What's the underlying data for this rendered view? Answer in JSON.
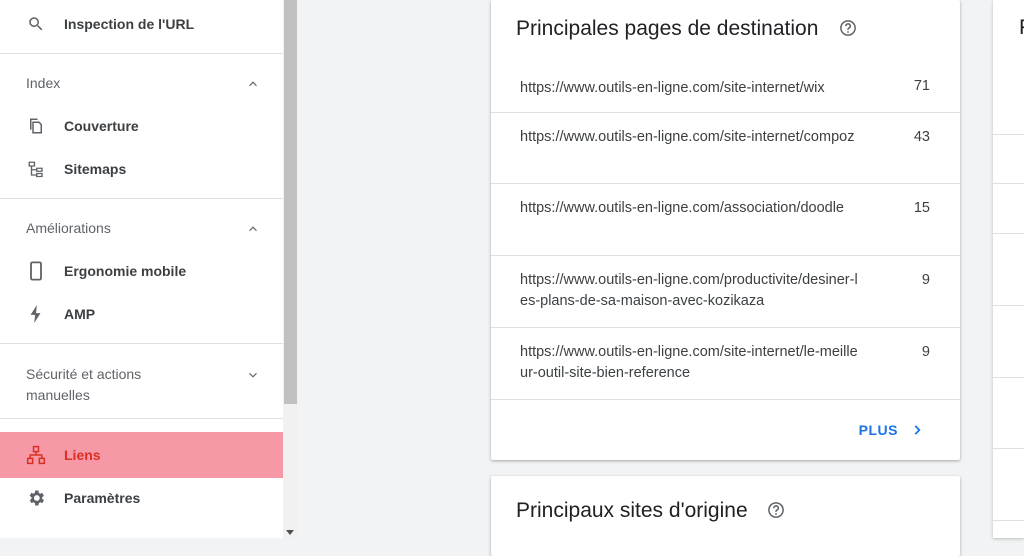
{
  "sidebar": {
    "url_inspection": "Inspection de l'URL",
    "sections": [
      {
        "title": "Index",
        "items": [
          "Couverture",
          "Sitemaps"
        ]
      },
      {
        "title": "Améliorations",
        "items": [
          "Ergonomie mobile",
          "AMP"
        ]
      },
      {
        "title": "Sécurité et actions manuelles"
      }
    ],
    "links": "Liens",
    "settings": "Paramètres"
  },
  "main": {
    "top_pages": {
      "title": "Principales pages de destination",
      "rows": [
        {
          "url": "https://www.outils-en-ligne.com/site-internet/wix",
          "count": "71"
        },
        {
          "url": "https://www.outils-en-ligne.com/site-internet/compoz",
          "count": "43"
        },
        {
          "url": "https://www.outils-en-ligne.com/association/doodle",
          "count": "15"
        },
        {
          "url": "https://www.outils-en-ligne.com/productivite/desiner-les-plans-de-sa-maison-avec-kozikaza",
          "count": "9"
        },
        {
          "url": "https://www.outils-en-ligne.com/site-internet/le-meilleur-outil-site-bien-reference",
          "count": "9"
        }
      ],
      "more_label": "PLUS"
    },
    "top_sites": {
      "title": "Principaux sites d'origine"
    },
    "right_panel_letter": "P"
  },
  "colors": {
    "active_bg": "#f698a6",
    "accent": "#1a73e8"
  }
}
